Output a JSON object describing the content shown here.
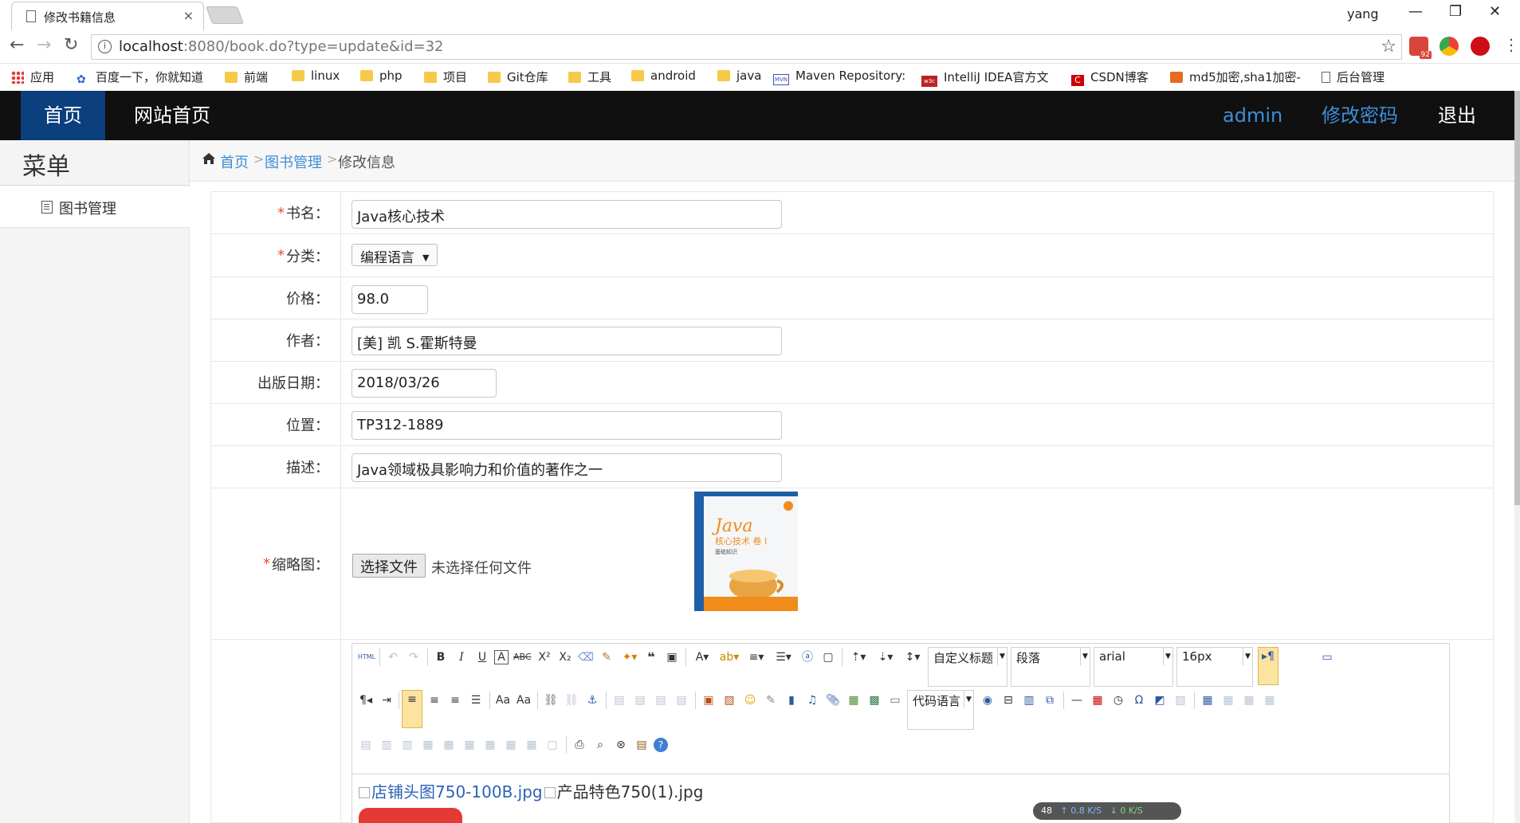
{
  "browser": {
    "tab_title": "修改书籍信息",
    "tab_close": "×",
    "user": "yang",
    "url_host": "localhost",
    "url_path": ":8080/book.do?type=update&id=32",
    "ext_badge": "92",
    "bookmarks": [
      {
        "label": "应用",
        "icon": "apps-icon"
      },
      {
        "label": "百度一下，你就知道",
        "icon": "baidu-icon"
      },
      {
        "label": "前端",
        "icon": "folder-icon"
      },
      {
        "label": "linux",
        "icon": "folder-icon"
      },
      {
        "label": "php",
        "icon": "folder-icon"
      },
      {
        "label": "项目",
        "icon": "folder-icon"
      },
      {
        "label": "Git仓库",
        "icon": "folder-icon"
      },
      {
        "label": "工具",
        "icon": "folder-icon"
      },
      {
        "label": "android",
        "icon": "folder-icon"
      },
      {
        "label": "java",
        "icon": "folder-icon"
      },
      {
        "label": "Maven Repository:",
        "icon": "mvn-icon"
      },
      {
        "label": "IntelliJ IDEA官方文",
        "icon": "w3c-icon"
      },
      {
        "label": "CSDN博客",
        "icon": "csdn-icon"
      },
      {
        "label": "md5加密,sha1加密-",
        "icon": "md5-icon"
      },
      {
        "label": "后台管理",
        "icon": "page-icon"
      }
    ]
  },
  "header": {
    "home": "首页",
    "site_home": "网站首页",
    "admin": "admin",
    "change_password": "修改密码",
    "logout": "退出"
  },
  "sidebar": {
    "title": "菜单",
    "items": [
      {
        "label": "图书管理"
      }
    ]
  },
  "breadcrumb": {
    "home": "首页",
    "section": "图书管理",
    "current": "修改信息",
    "sep": ">"
  },
  "form": {
    "required_mark": "*",
    "name_label": "书名：",
    "name_value": "Java核心技术",
    "category_label": "分类：",
    "category_value": "编程语言",
    "price_label": "价格：",
    "price_value": "98.0",
    "author_label": "作者：",
    "author_value": "[美] 凯 S.霍斯特曼",
    "date_label": "出版日期：",
    "date_value": "2018/03/26",
    "location_label": "位置：",
    "location_value": "TP312-1889",
    "desc_label": "描述：",
    "desc_value": "Java领域极具影响力和价值的著作之一",
    "thumb_label": "缩略图：",
    "file_button": "选择文件",
    "file_status": "未选择任何文件",
    "cover": {
      "title_en": "Java",
      "title_cn": "核心技术 卷 I",
      "subtitle": "基础知识"
    }
  },
  "editor": {
    "selects": {
      "heading": "自定义标题",
      "paragraph": "段落",
      "font": "arial",
      "size": "16px",
      "code": "代码语言"
    },
    "html_label": "HTML",
    "content_text": "店铺头图750-100B.jpg",
    "content_text2": "产品特色750(1).jpg"
  },
  "netmon": {
    "count": "48",
    "up": "↑ 0.8 K/S",
    "down": "↓ 0 K/S"
  },
  "colors": {
    "nav_bg": "#101010",
    "nav_active": "#0b3f7e",
    "link": "#3e8ed6",
    "required": "#e0522a"
  }
}
